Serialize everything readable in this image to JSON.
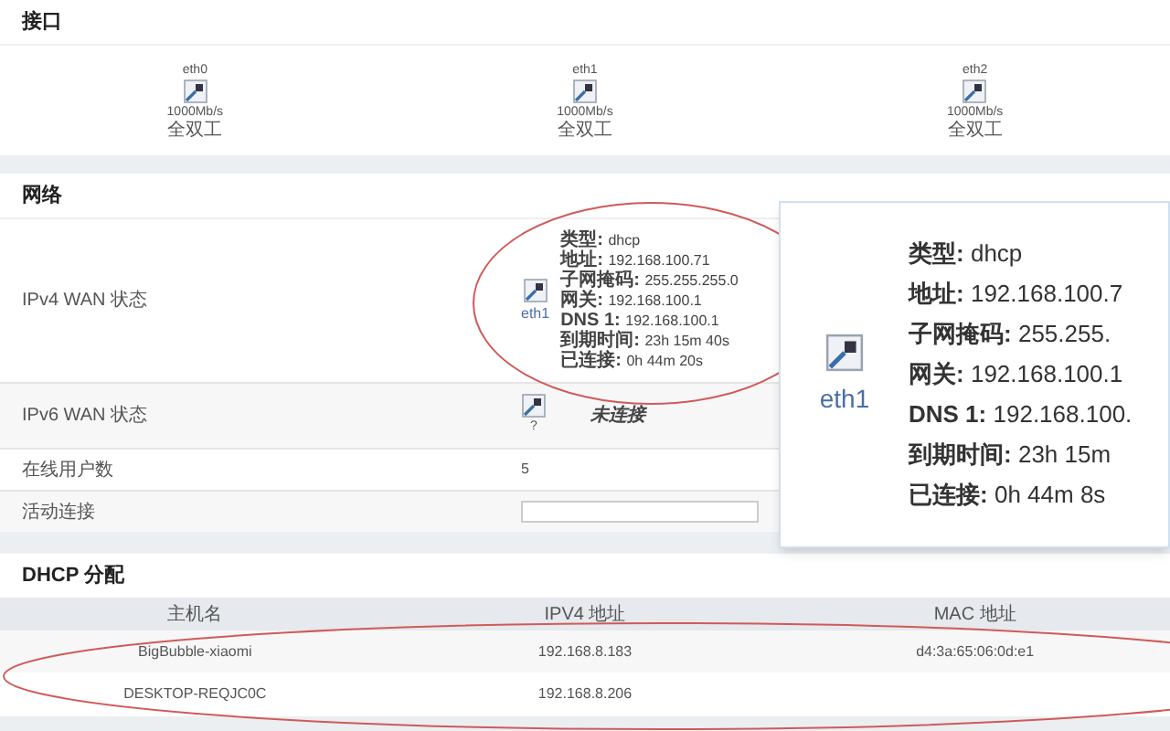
{
  "interfaces": {
    "title": "接口",
    "ports": [
      {
        "name": "eth0",
        "speed": "1000Mb/s",
        "duplex": "全双工"
      },
      {
        "name": "eth1",
        "speed": "1000Mb/s",
        "duplex": "全双工"
      },
      {
        "name": "eth2",
        "speed": "1000Mb/s",
        "duplex": "全双工"
      }
    ]
  },
  "network": {
    "title": "网络",
    "ipv4": {
      "label": "IPv4 WAN 状态",
      "interface": "eth1",
      "details": [
        {
          "key": "类型:",
          "value": "dhcp"
        },
        {
          "key": "地址:",
          "value": "192.168.100.71"
        },
        {
          "key": "子网掩码:",
          "value": "255.255.255.0"
        },
        {
          "key": "网关:",
          "value": "192.168.100.1"
        },
        {
          "key": "DNS 1:",
          "value": "192.168.100.1"
        },
        {
          "key": "到期时间:",
          "value": "23h 15m 40s"
        },
        {
          "key": "已连接:",
          "value": "0h 44m 20s"
        }
      ]
    },
    "ipv6": {
      "label": "IPv6 WAN 状态",
      "interface": "?",
      "status": "未连接"
    },
    "online_users": {
      "label": "在线用户数",
      "value": "5"
    },
    "active_connections": {
      "label": "活动连接",
      "level": 0
    }
  },
  "callout": {
    "interface": "eth1",
    "details": [
      {
        "key": "类型:",
        "value": "dhcp"
      },
      {
        "key": "地址:",
        "value": "192.168.100.7"
      },
      {
        "key": "子网掩码:",
        "value": "255.255."
      },
      {
        "key": "网关:",
        "value": "192.168.100.1"
      },
      {
        "key": "DNS 1:",
        "value": "192.168.100."
      },
      {
        "key": "到期时间:",
        "value": "23h 15m"
      },
      {
        "key": "已连接:",
        "value": "0h 44m 8s"
      }
    ]
  },
  "dhcp": {
    "title": "DHCP 分配",
    "columns": [
      "主机名",
      "IPV4 地址",
      "MAC 地址"
    ],
    "rows": [
      {
        "hostname": "BigBubble-xiaomi",
        "ipv4": "192.168.8.183",
        "mac": "d4:3a:65:06:0d:e1"
      },
      {
        "hostname": "DESKTOP-REQJC0C",
        "ipv4": "192.168.8.206"
      }
    ]
  }
}
